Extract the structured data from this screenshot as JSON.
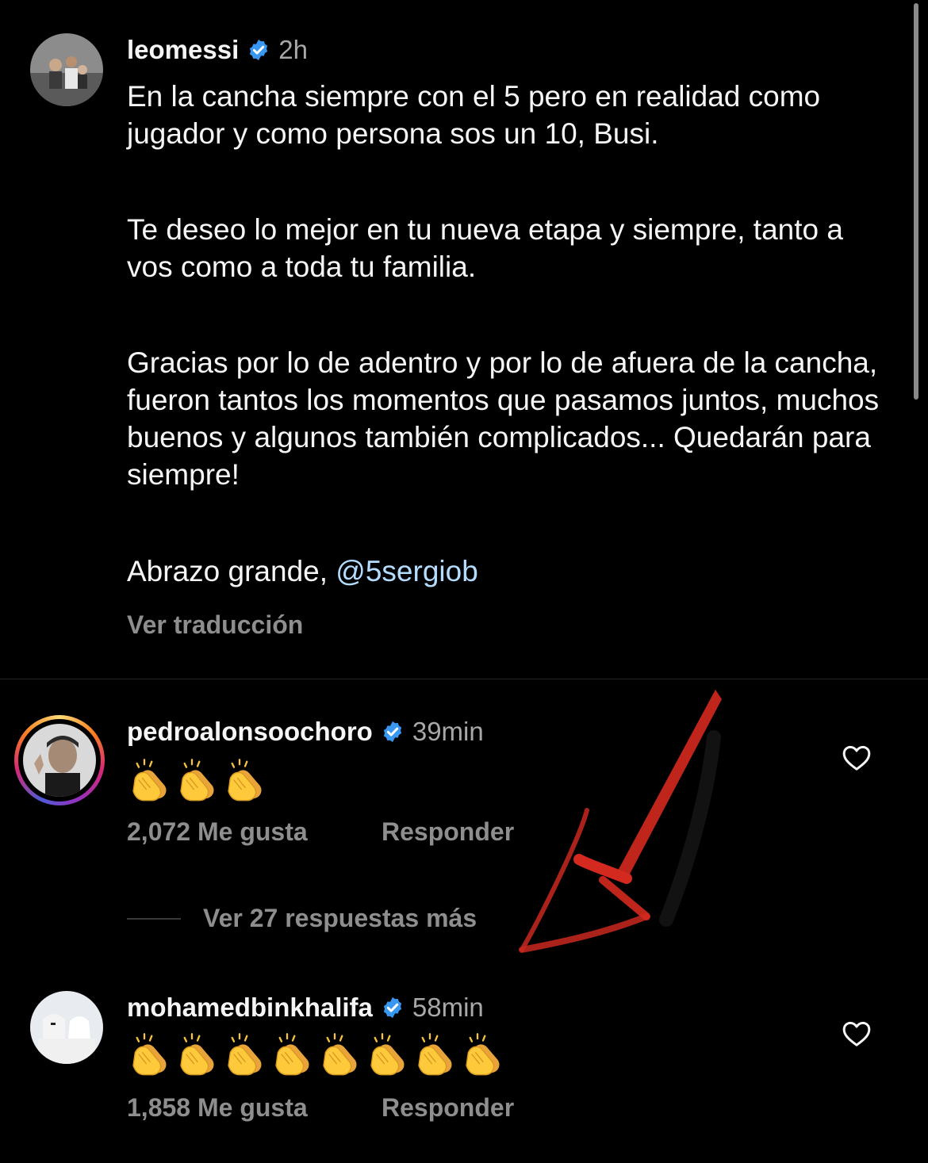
{
  "post": {
    "username": "leomessi",
    "time": "2h",
    "caption": [
      "En la cancha siempre con el 5 pero en realidad como jugador y como persona sos un 10, Busi.",
      "Te deseo lo mejor en tu nueva etapa y siempre, tanto a vos como a toda tu familia.",
      "Gracias por lo de adentro y por lo de afuera de la cancha, fueron tantos los momentos que pasamos juntos, muchos buenos y algunos también complicados... Quedarán para siempre!"
    ],
    "closing_text": "Abrazo grande, ",
    "mention": "@5sergiob",
    "translate_label": "Ver traducción"
  },
  "comments": [
    {
      "username": "pedroalonsoochoro",
      "time": "39min",
      "clap_count": 3,
      "likes": "2,072 Me gusta",
      "reply_label": "Responder",
      "has_story_ring": true
    },
    {
      "username": "mohamedbinkhalifa",
      "time": "58min",
      "clap_count": 8,
      "likes": "1,858 Me gusta",
      "reply_label": "Responder",
      "has_story_ring": false
    }
  ],
  "view_replies_label": "Ver 27 respuestas más",
  "icons": {
    "verified": "verified-badge-icon",
    "like": "heart-outline-icon",
    "clap": "clapping-hands-emoji"
  },
  "colors": {
    "background": "#000000",
    "text": "#f5f5f5",
    "secondary": "#8e8e8e",
    "verified_blue": "#3897f0",
    "annotation_arrow": "#d4291e"
  }
}
